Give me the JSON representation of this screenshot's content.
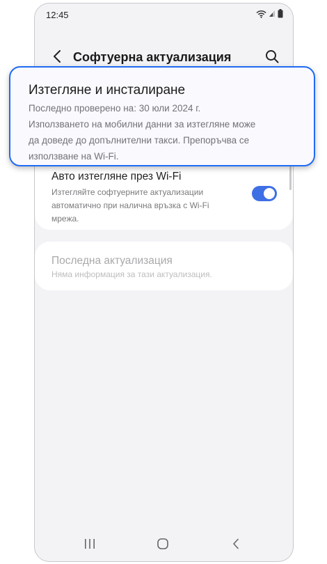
{
  "status_bar": {
    "time": "12:45",
    "icons": [
      "wifi-icon",
      "signal-icon",
      "battery-icon"
    ]
  },
  "app_bar": {
    "title": "Софтуерна актуализация",
    "back_icon": "chevron-left-icon",
    "search_icon": "search-icon"
  },
  "highlight_item": {
    "title": "Изтегляне и инсталиране",
    "description_lines": [
      "Последно проверено на: 30 юли 2024 г.",
      "Използването на мобилни данни за изтегляне може",
      "да доведе до допълнителни такси. Препоръчва се",
      "използване на Wi-Fi."
    ]
  },
  "auto_download": {
    "title": "Авто изтегляне през Wi-Fi",
    "description_lines": [
      "Изтегляйте софтуерните актуализации",
      "автоматично при налична връзка с Wi-Fi",
      "мрежа."
    ],
    "toggle_on": true
  },
  "last_update": {
    "title": "Последна актуализация",
    "description": "Няма информация за тази актуализация."
  },
  "colors": {
    "accent": "#3e6fe4",
    "highlight_border": "#1f6bf5",
    "screen_bg": "#f3f3f6"
  },
  "nav_bar": {
    "icons": [
      "recents-icon",
      "home-icon",
      "back-icon"
    ]
  }
}
